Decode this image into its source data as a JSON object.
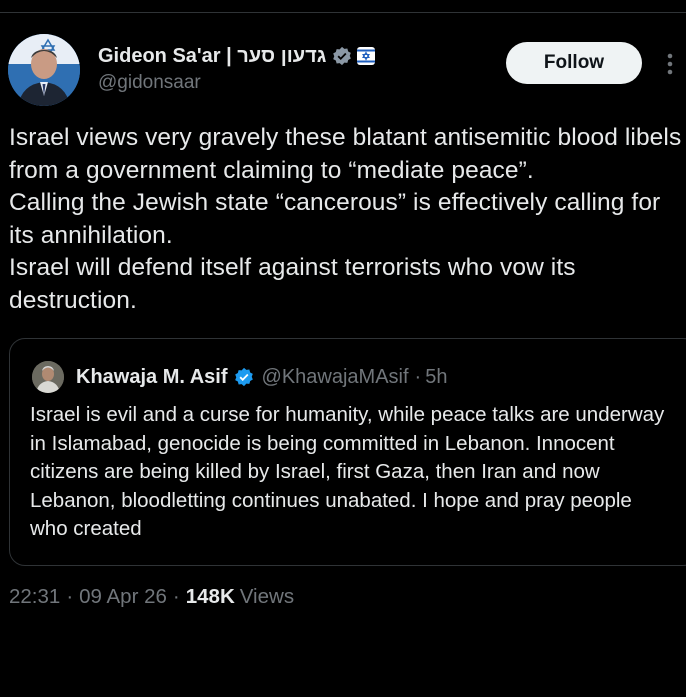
{
  "tweet": {
    "author": {
      "display_name": "Gideon Sa'ar | גדעון סער",
      "handle": "@gidonsaar",
      "verified_icon": "verified-badge-icon",
      "affiliation_icon": "government-affiliation-icon"
    },
    "follow_label": "Follow",
    "more_icon": "more-options-icon",
    "text": "Israel views very gravely these blatant antisemitic blood libels from a government claiming to “mediate peace”.\nCalling the Jewish state “cancerous” is effectively calling for its annihilation.\nIsrael will defend itself against terrorists who vow its destruction.",
    "quoted": {
      "display_name": "Khawaja M. Asif",
      "handle": "@KhawajaMAsif",
      "separator": "·",
      "time": "5h",
      "text": "Israel is evil and a curse for humanity, while peace talks are underway in Islamabad, genocide is being committed in Lebanon. Innocent citizens are being killed by Israel, first Gaza, then Iran and now Lebanon, bloodletting continues unabated. I hope and pray people who created"
    },
    "meta": {
      "time": "22:31",
      "date": "09 Apr 26",
      "separator": "·",
      "views_count": "148K",
      "views_label": "Views"
    }
  },
  "colors": {
    "background": "#000000",
    "text_primary": "#e7e9ea",
    "text_secondary": "#71767b",
    "verified_blue": "#1d9bf0",
    "border": "#2f3336",
    "follow_bg": "#eff3f4"
  }
}
